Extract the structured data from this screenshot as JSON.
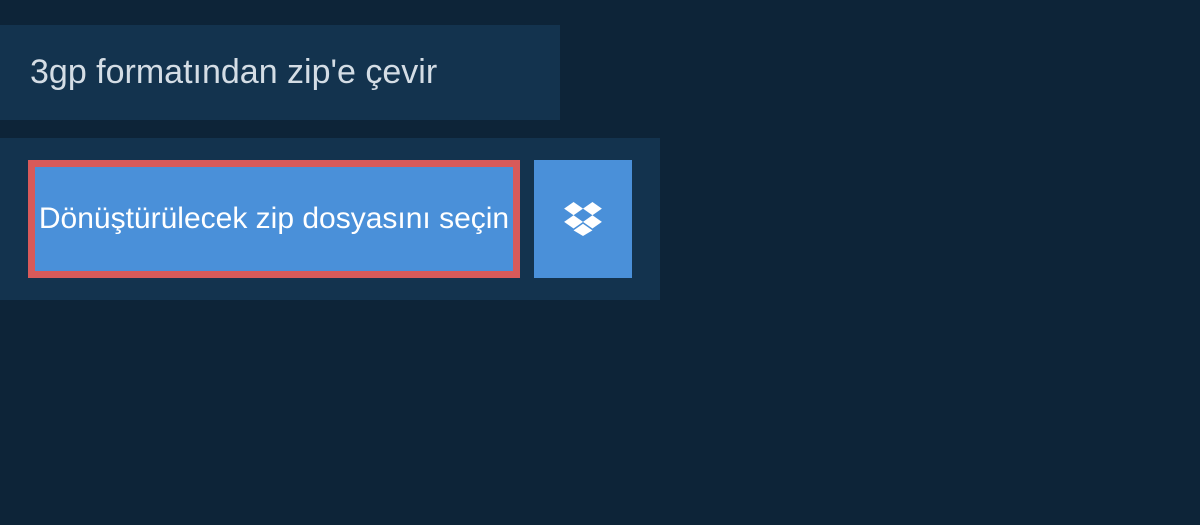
{
  "header": {
    "title": "3gp formatından zip'e çevir"
  },
  "upload": {
    "select_label": "Dönüştürülecek zip dosyasını seçin"
  },
  "colors": {
    "bg": "#0d2438",
    "panel": "#13334e",
    "button": "#4a90d9",
    "highlight": "#d85a5a",
    "text": "#d4dde5"
  }
}
